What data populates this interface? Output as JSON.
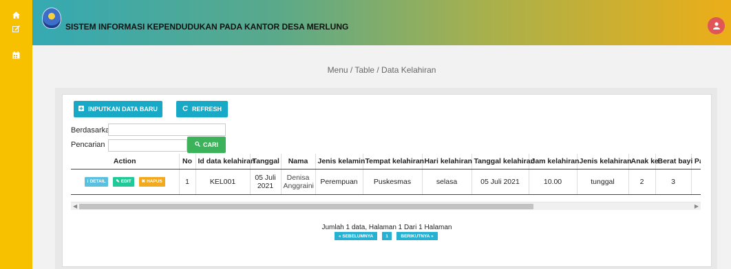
{
  "app": {
    "title": "SISTEM INFORMASI KEPENDUDUKAN PADA KANTOR DESA MERLUNG"
  },
  "sidebar": {
    "icons": [
      "home-icon",
      "edit-icon",
      "calendar-icon"
    ]
  },
  "breadcrumb": "Menu / Table / Data Kelahiran",
  "toolbar": {
    "add_label": "INPUTKAN DATA BARU",
    "refresh_label": "REFRESH"
  },
  "search": {
    "basis_label": "Berdasarkan:",
    "basis_value": "",
    "query_label": "Pencarian",
    "query_value": "",
    "button_label": "CARI"
  },
  "table": {
    "headers": [
      "Action",
      "No",
      "Id data kelahiran",
      "Tanggal",
      "Nama",
      "Jenis kelamin",
      "Tempat kelahiran",
      "Hari kelahiran",
      "Tanggal kelahiran",
      "Jam kelahiran",
      "Jenis kelahiran",
      "Anak ke",
      "Berat bayi",
      "Pan"
    ],
    "action_labels": {
      "detail": "DETAIL",
      "edit": "EDIT",
      "delete": "HAPUS"
    },
    "rows": [
      {
        "no": "1",
        "id": "KEL001",
        "tanggal": "05 Juli 2021",
        "nama": "Denisa Anggraini",
        "jenis_kelamin": "Perempuan",
        "tempat": "Puskesmas",
        "hari": "selasa",
        "tanggal_kelahiran": "05 Juli 2021",
        "jam": "10.00",
        "jenis_kelahiran": "tunggal",
        "anak_ke": "2",
        "berat": "3",
        "panjang": ""
      }
    ]
  },
  "pagination": {
    "summary": "Jumlah 1 data, Halaman 1 Dari 1 Halaman",
    "prev_label": "« SEBELUMNYA",
    "page": "1",
    "next_label": "BERIKUTNYA »"
  },
  "colors": {
    "sidebar": "#f7c100",
    "primary": "#17a9c6",
    "success": "#3cb35a",
    "warning": "#f2a91d",
    "detail": "#5bc0de",
    "avatar": "#e05555"
  }
}
